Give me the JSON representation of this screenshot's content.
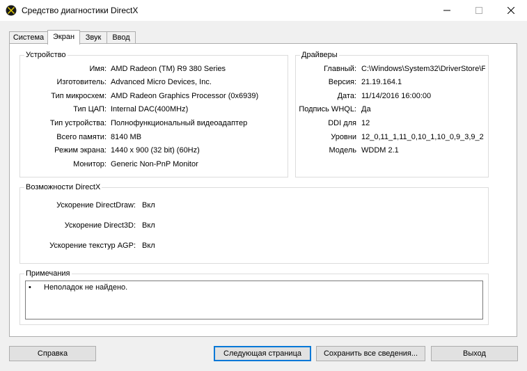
{
  "window": {
    "title": "Средство диагностики DirectX"
  },
  "tabs": [
    {
      "label": "Система"
    },
    {
      "label": "Экран"
    },
    {
      "label": "Звук"
    },
    {
      "label": "Ввод"
    }
  ],
  "device": {
    "title": "Устройство",
    "rows": [
      {
        "label": "Имя:",
        "value": "AMD Radeon (TM) R9 380 Series"
      },
      {
        "label": "Изготовитель:",
        "value": "Advanced Micro Devices, Inc."
      },
      {
        "label": "Тип микросхем:",
        "value": "AMD Radeon Graphics Processor (0x6939)"
      },
      {
        "label": "Тип ЦАП:",
        "value": "Internal DAC(400MHz)"
      },
      {
        "label": "Тип устройства:",
        "value": "Полнофункциональный видеоадаптер"
      },
      {
        "label": "Всего памяти:",
        "value": "8140 MB"
      },
      {
        "label": "Режим экрана:",
        "value": "1440 x 900 (32 bit) (60Hz)"
      },
      {
        "label": "Монитор:",
        "value": "Generic Non-PnP Monitor"
      }
    ]
  },
  "drivers": {
    "title": "Драйверы",
    "rows": [
      {
        "label": "Главный:",
        "value": "C:\\Windows\\System32\\DriverStore\\F"
      },
      {
        "label": "Версия:",
        "value": "21.19.164.1"
      },
      {
        "label": "Дата:",
        "value": "11/14/2016 16:00:00"
      },
      {
        "label": "Подпись WHQL:",
        "value": "Да"
      },
      {
        "label": "DDI для",
        "value": "12"
      },
      {
        "label": "Уровни",
        "value": "12_0,11_1,11_0,10_1,10_0,9_3,9_2"
      },
      {
        "label": "Модель",
        "value": "WDDM 2.1"
      }
    ]
  },
  "directx": {
    "title": "Возможности DirectX",
    "rows": [
      {
        "label": "Ускорение DirectDraw:",
        "value": "Вкл"
      },
      {
        "label": "Ускорение Direct3D:",
        "value": "Вкл"
      },
      {
        "label": "Ускорение текстур AGP:",
        "value": "Вкл"
      }
    ]
  },
  "notes": {
    "title": "Примечания",
    "bullet": "•",
    "text": "Неполадок не найдено."
  },
  "buttons": {
    "help": "Справка",
    "next": "Следующая страница",
    "save": "Сохранить все сведения...",
    "exit": "Выход"
  },
  "colors": {
    "accent": "#0078d7",
    "panel": "#ffffff",
    "background": "#f0f0f0"
  },
  "icons": {
    "app": "directx-x-icon",
    "minimize": "minimize-icon",
    "maximize": "maximize-icon",
    "close": "close-icon"
  }
}
